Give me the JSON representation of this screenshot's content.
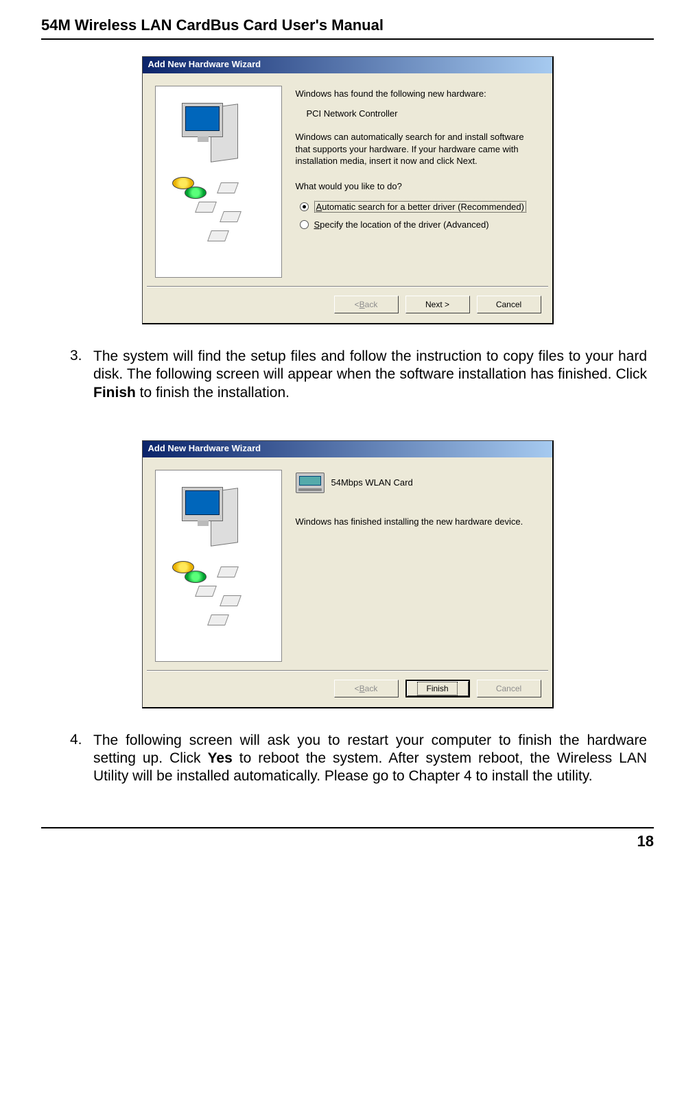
{
  "doc": {
    "header": "54M Wireless LAN CardBus Card User's Manual",
    "page_number": "18"
  },
  "wizard1": {
    "title": "Add New Hardware Wizard",
    "line1": "Windows has found the following new hardware:",
    "device": "PCI Network Controller",
    "para1": "Windows can automatically search for and install software that supports your hardware. If your hardware came with installation media, insert it now and click Next.",
    "prompt": "What would you like to do?",
    "opt1_pre": "A",
    "opt1_rest": "utomatic search for a better driver (Recommended)",
    "opt2_pre": "S",
    "opt2_rest": "pecify the location of the driver (Advanced)",
    "back_pre": "< ",
    "back_u": "B",
    "back_rest": "ack",
    "next": "Next >",
    "cancel": "Cancel"
  },
  "step3": {
    "num": "3.",
    "text_a": "The system will find the setup files and follow the instruction to copy files to your hard disk. The following screen will appear when the software installation has finished. Click ",
    "text_bold": "Finish",
    "text_b": " to finish the installation."
  },
  "wizard2": {
    "title": "Add New Hardware Wizard",
    "device_label": "54Mbps WLAN Card",
    "done_line": "Windows has finished installing the new hardware device.",
    "back_pre": "< ",
    "back_u": "B",
    "back_rest": "ack",
    "finish": "Finish",
    "cancel": "Cancel"
  },
  "step4": {
    "num": "4.",
    "text_a": "The following screen will ask you to restart your computer to finish the hardware setting up. Click ",
    "text_bold": "Yes",
    "text_b": " to reboot the system. After system reboot, the Wireless LAN Utility will be installed automatically. Please go to Chapter 4 to install the utility."
  }
}
